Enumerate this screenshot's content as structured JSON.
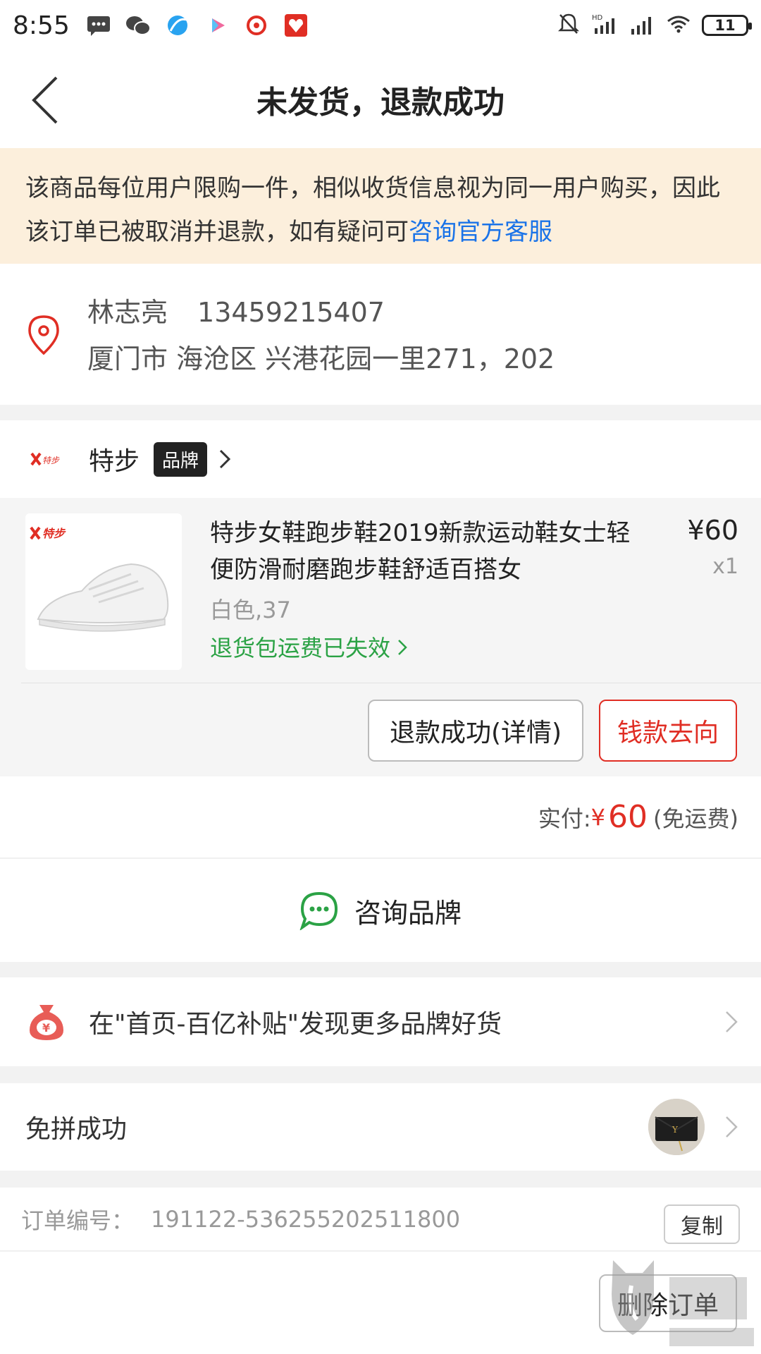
{
  "status_bar": {
    "time": "8:55",
    "battery": "11",
    "icons": [
      "message-icon",
      "wechat-icon",
      "browser-icon",
      "video-icon",
      "music-icon",
      "app-icon",
      "mute-bell-icon",
      "signal-hd-icon",
      "signal-icon",
      "wifi-icon",
      "battery-icon"
    ]
  },
  "nav": {
    "title": "未发货，退款成功"
  },
  "notice": {
    "text": "该商品每位用户限购一件，相似收货信息视为同一用户购买，因此该订单已被取消并退款，如有疑问可",
    "link": "咨询官方客服"
  },
  "address": {
    "name": "林志亮",
    "phone": "13459215407",
    "detail": "厦门市 海沧区 兴港花园一里271，202"
  },
  "store": {
    "name": "特步",
    "tag": "品牌"
  },
  "product": {
    "title": "特步女鞋跑步鞋2019新款运动鞋女士轻便防滑耐磨跑步鞋舒适百搭女",
    "price": "¥60",
    "qty": "x1",
    "spec": "白色,37",
    "return_shipping": "退货包运费已失效",
    "btn_refund": "退款成功(详情)",
    "btn_money": "钱款去向"
  },
  "payment": {
    "label": "实付:",
    "currency": "¥",
    "amount": "60",
    "note": "(免运费)"
  },
  "consult": {
    "label": "咨询品牌"
  },
  "subsidy": {
    "text": "在\"首页-百亿补贴\"发现更多品牌好货"
  },
  "group": {
    "label": "免拼成功"
  },
  "order": {
    "label": "订单编号：",
    "number": "191122-536255202511800",
    "copy": "复制"
  },
  "footer": {
    "delete": "删除订单"
  },
  "colors": {
    "accent": "#e02e24",
    "link": "#1a73e8",
    "green": "#2ba245",
    "notice_bg": "#fcefdc"
  }
}
